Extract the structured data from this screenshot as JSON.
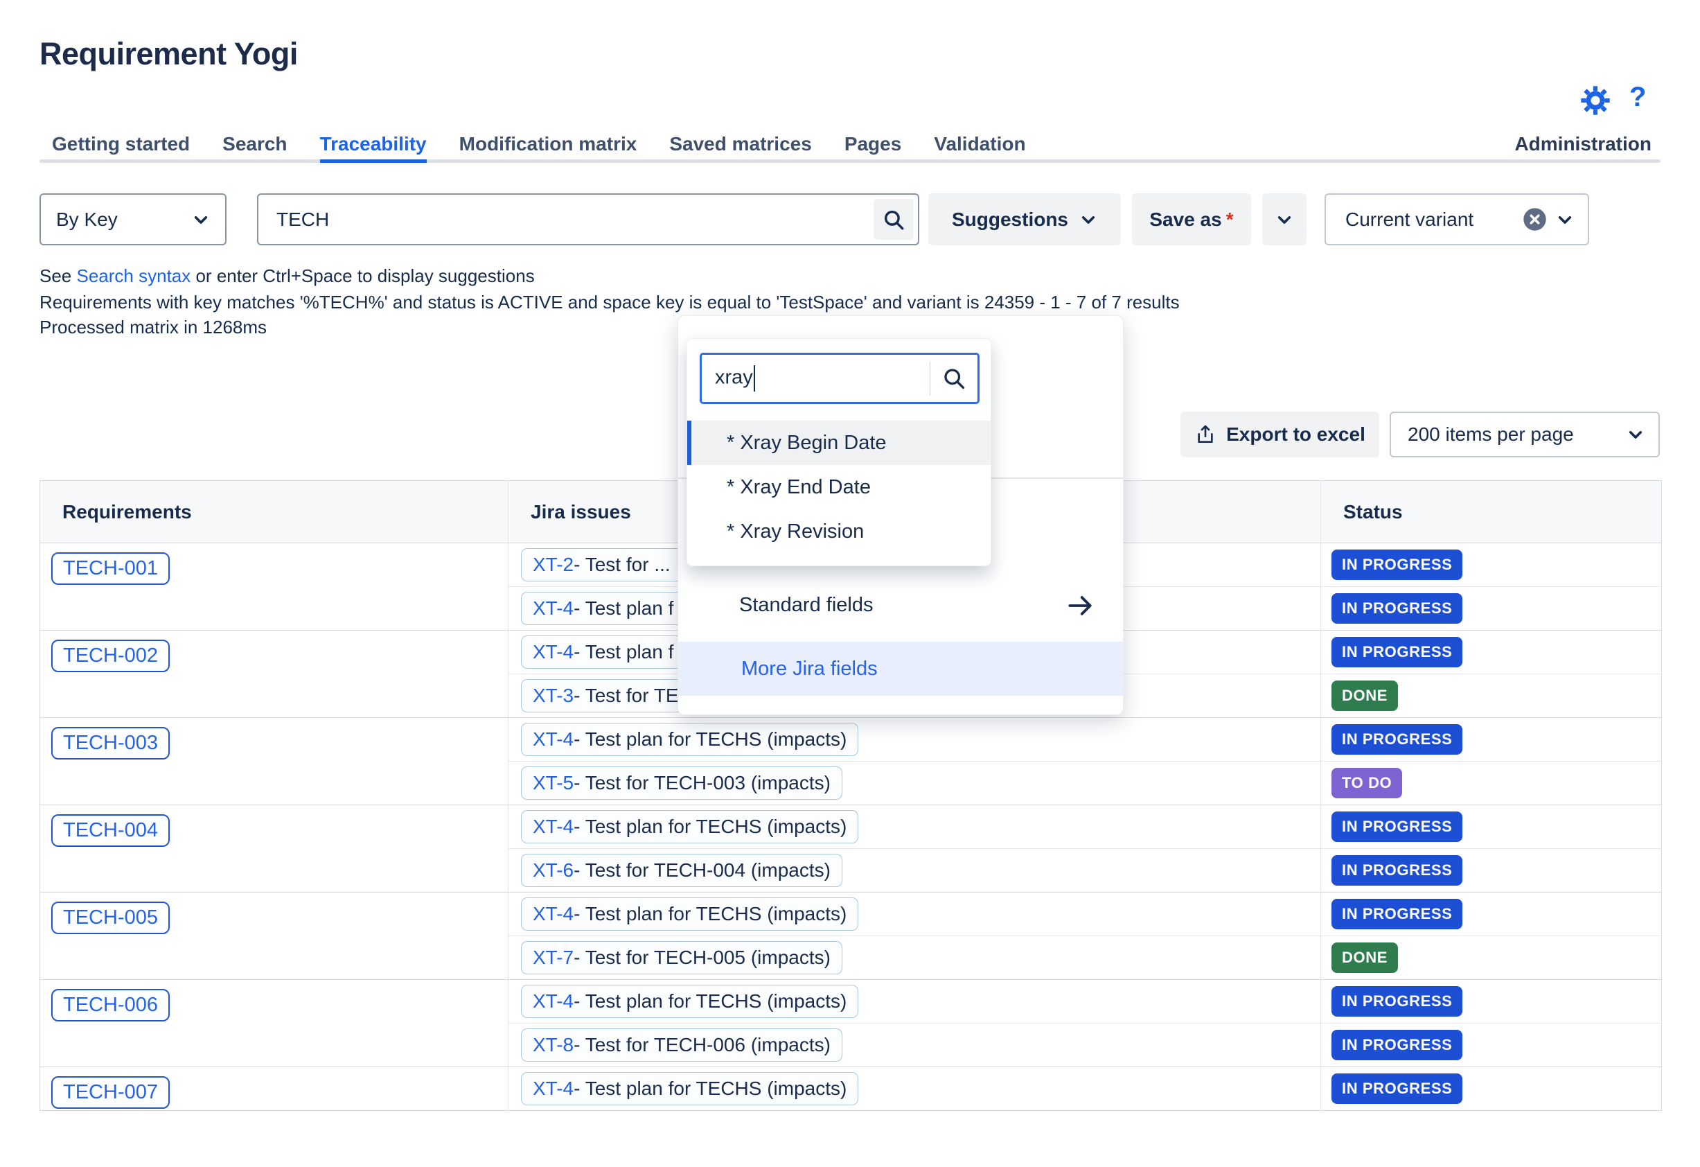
{
  "header": {
    "title": "Requirement Yogi",
    "help_label": "?"
  },
  "tabs": [
    {
      "label": "Getting started",
      "active": false
    },
    {
      "label": "Search",
      "active": false
    },
    {
      "label": "Traceability",
      "active": true
    },
    {
      "label": "Modification matrix",
      "active": false
    },
    {
      "label": "Saved matrices",
      "active": false
    },
    {
      "label": "Pages",
      "active": false
    },
    {
      "label": "Validation",
      "active": false
    }
  ],
  "administration_label": "Administration",
  "toolbar": {
    "by_key_label": "By Key",
    "search_value": "TECH",
    "suggestions_label": "Suggestions",
    "save_as_label": "Save as",
    "save_as_required_mark": "*",
    "current_variant_label": "Current variant"
  },
  "notes": {
    "syntax_pre": "See ",
    "syntax_link": "Search syntax",
    "syntax_post": " or enter Ctrl+Space to display suggestions",
    "query_summary": "Requirements with key matches '%TECH%' and status is ACTIVE and space key is equal to 'TestSpace' and variant is 24359 - 1 - 7 of 7 results",
    "processed": "Processed matrix in 1268ms"
  },
  "results_bar": {
    "export_label": "Export to excel",
    "items_per_page_value": "200 items per page"
  },
  "popup": {
    "search_value": "xray",
    "fields": [
      "* Xray Begin Date",
      "* Xray End Date",
      "* Xray Revision"
    ],
    "selected_index": 0,
    "standard_fields_label": "Standard fields",
    "more_jira_fields_label": "More Jira fields"
  },
  "table": {
    "columns": [
      "Requirements",
      "Jira issues",
      "Status"
    ],
    "status_colors": {
      "IN PROGRESS": "#1C4FD3",
      "DONE": "#2F7D4F",
      "TO DO": "#7E63D2"
    },
    "groups": [
      {
        "req": "TECH-001",
        "issues": [
          {
            "key": "XT-2",
            "text": " - Test for ...",
            "clipped": true,
            "status": "IN PROGRESS"
          },
          {
            "key": "XT-4",
            "text": " - Test plan f",
            "clipped": true,
            "status": "IN PROGRESS"
          }
        ]
      },
      {
        "req": "TECH-002",
        "issues": [
          {
            "key": "XT-4",
            "text": " - Test plan f",
            "clipped": true,
            "status": "IN PROGRESS"
          },
          {
            "key": "XT-3",
            "text": " - Test for TE",
            "clipped": true,
            "status": "DONE"
          }
        ]
      },
      {
        "req": "TECH-003",
        "issues": [
          {
            "key": "XT-4",
            "text": " - Test plan for TECHS (impacts)",
            "clipped": false,
            "status": "IN PROGRESS"
          },
          {
            "key": "XT-5",
            "text": " - Test for TECH-003 (impacts)",
            "clipped": false,
            "status": "TO DO"
          }
        ]
      },
      {
        "req": "TECH-004",
        "issues": [
          {
            "key": "XT-4",
            "text": " - Test plan for TECHS (impacts)",
            "clipped": false,
            "status": "IN PROGRESS"
          },
          {
            "key": "XT-6",
            "text": " - Test for TECH-004 (impacts)",
            "clipped": false,
            "status": "IN PROGRESS"
          }
        ]
      },
      {
        "req": "TECH-005",
        "issues": [
          {
            "key": "XT-4",
            "text": " - Test plan for TECHS (impacts)",
            "clipped": false,
            "status": "IN PROGRESS"
          },
          {
            "key": "XT-7",
            "text": " - Test for TECH-005 (impacts)",
            "clipped": false,
            "status": "DONE"
          }
        ]
      },
      {
        "req": "TECH-006",
        "issues": [
          {
            "key": "XT-4",
            "text": " - Test plan for TECHS (impacts)",
            "clipped": false,
            "status": "IN PROGRESS"
          },
          {
            "key": "XT-8",
            "text": " - Test for TECH-006 (impacts)",
            "clipped": false,
            "status": "IN PROGRESS"
          }
        ]
      },
      {
        "req": "TECH-007",
        "issues": [
          {
            "key": "XT-4",
            "text": " - Test plan for TECHS (impacts)",
            "clipped": false,
            "status": "IN PROGRESS"
          }
        ]
      }
    ]
  }
}
